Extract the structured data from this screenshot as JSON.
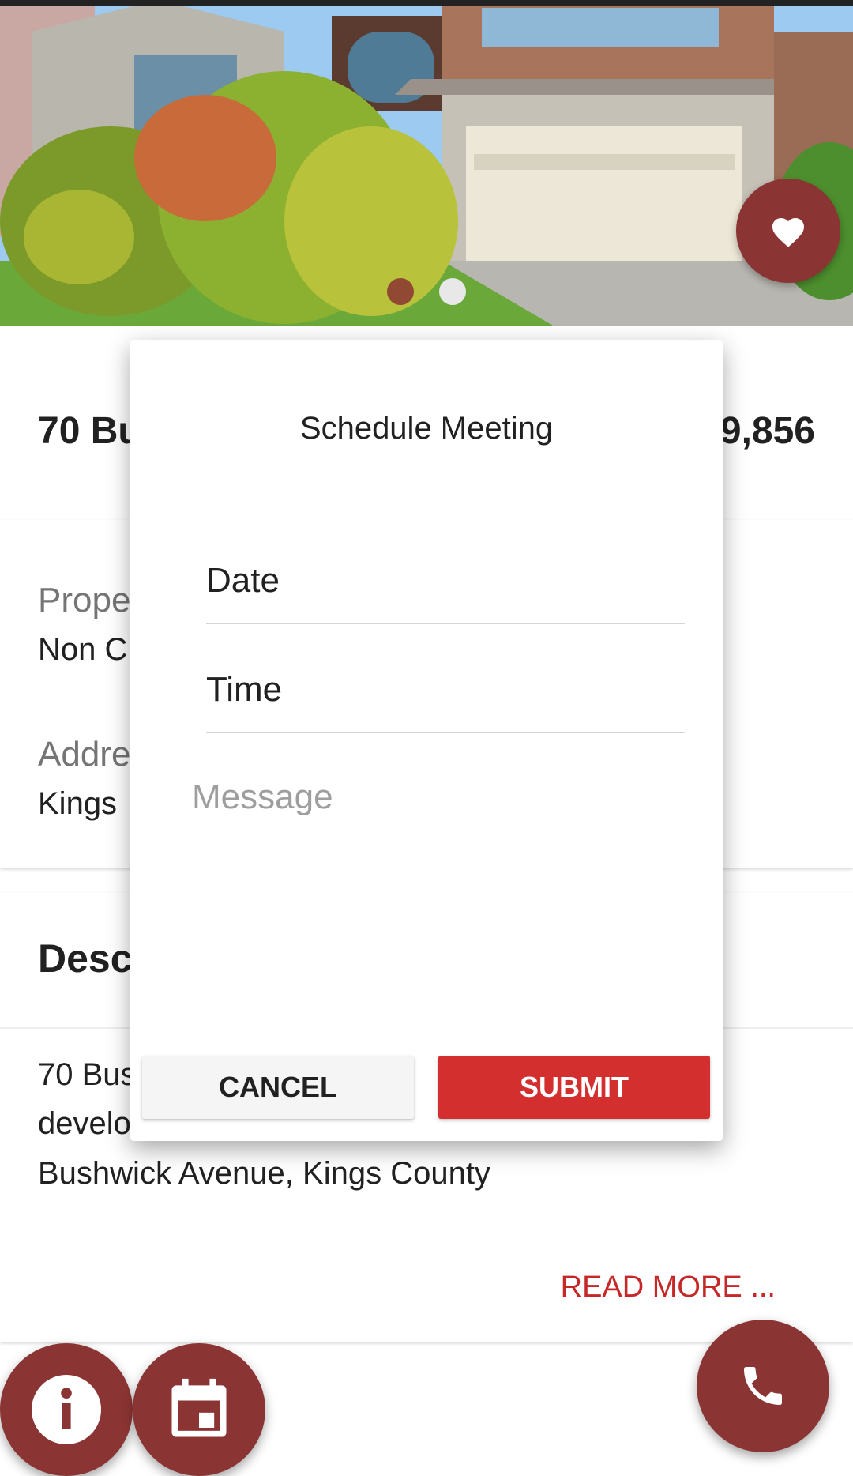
{
  "listing": {
    "title_partial": "70 Bu",
    "price_partial": "9,856",
    "property_label_partial": "Prope",
    "property_value_partial": "Non C",
    "address_label_partial": "Addre",
    "address_value_partial": "Kings",
    "description_heading_partial": "Desc",
    "description_lines": [
      "70 Bus",
      "develo",
      "Bushwick Avenue, Kings County"
    ],
    "read_more": "READ MORE ..."
  },
  "dialog": {
    "title": "Schedule Meeting",
    "date_label": "Date",
    "time_label": "Time",
    "message_placeholder": "Message",
    "cancel_label": "CANCEL",
    "submit_label": "SUBMIT"
  },
  "icons": {
    "favorite": "heart-icon",
    "info": "info-icon",
    "calendar": "calendar-icon",
    "call": "phone-icon"
  },
  "colors": {
    "accent": "#8b3434",
    "submit": "#d32f2f",
    "read_more": "#c62828"
  }
}
